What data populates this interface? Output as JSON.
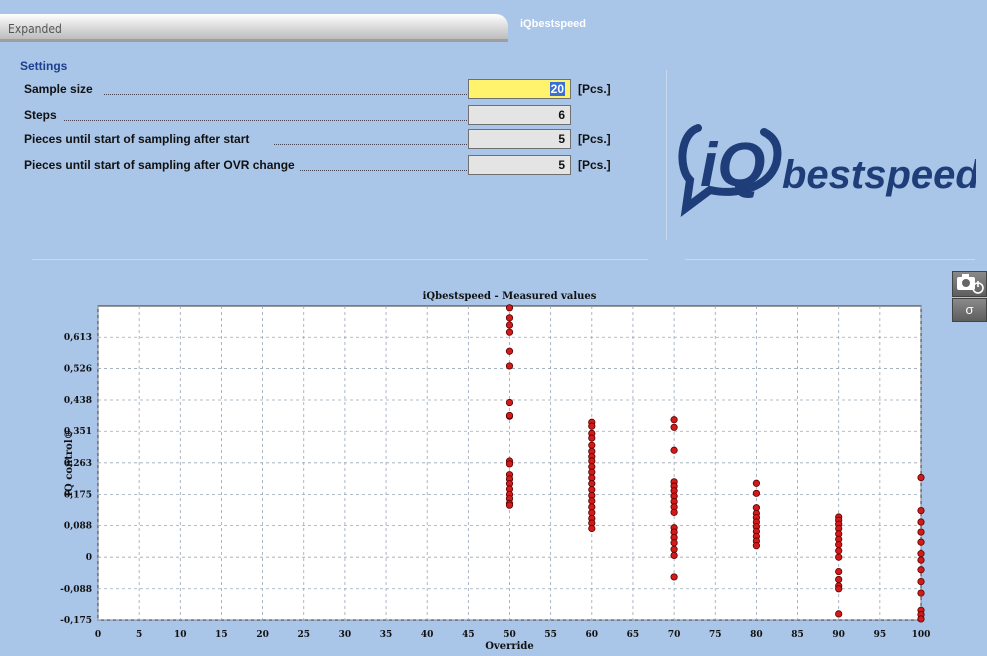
{
  "tabs": {
    "expanded": "Expanded",
    "active": "iQbestspeed"
  },
  "settings": {
    "title": "Settings",
    "rows": [
      {
        "label": "Sample size",
        "value": "20",
        "unit": "[Pcs.]"
      },
      {
        "label": "Steps",
        "value": "6",
        "unit": ""
      },
      {
        "label": "Pieces until start of sampling after start",
        "value": "5",
        "unit": "[Pcs.]"
      },
      {
        "label": "Pieces until start of sampling after OVR change",
        "value": "5",
        "unit": "[Pcs.]"
      }
    ]
  },
  "logo": {
    "mark": "iQ",
    "text": "bestspeed"
  },
  "side_buttons": {
    "camera_icon": "camera-power-icon",
    "sigma_label": "σ"
  },
  "colors": {
    "background": "#a9c5e8",
    "point": "#d11a1a",
    "field_active": "#fff36e"
  },
  "chart_data": {
    "type": "scatter",
    "title": "iQbestspeed - Measured values",
    "xlabel": "Override",
    "ylabel": "IQ control®",
    "xlim": [
      0,
      100
    ],
    "ylim": [
      -0.175,
      0.7
    ],
    "xticks": [
      "0",
      "5",
      "10",
      "15",
      "20",
      "25",
      "30",
      "35",
      "40",
      "45",
      "50",
      "55",
      "60",
      "65",
      "70",
      "75",
      "80",
      "85",
      "90",
      "95",
      "100"
    ],
    "yticks": [
      {
        "v": 0.613,
        "label": "0,613"
      },
      {
        "v": 0.526,
        "label": "0,526"
      },
      {
        "v": 0.438,
        "label": "0,438"
      },
      {
        "v": 0.351,
        "label": "0,351"
      },
      {
        "v": 0.263,
        "label": "0,263"
      },
      {
        "v": 0.175,
        "label": "0,175"
      },
      {
        "v": 0.088,
        "label": "0,088"
      },
      {
        "v": 0,
        "label": "0"
      },
      {
        "v": -0.088,
        "label": "-0,088"
      },
      {
        "v": -0.175,
        "label": "-0,175"
      }
    ],
    "grid": true,
    "series": [
      {
        "x": 50,
        "y": [
          0.695,
          0.667,
          0.647,
          0.627,
          0.574,
          0.533,
          0.431,
          0.393,
          0.395,
          0.268,
          0.26,
          0.23,
          0.218,
          0.205,
          0.19,
          0.175,
          0.163,
          0.15,
          0.145
        ]
      },
      {
        "x": 60,
        "y": [
          0.376,
          0.365,
          0.345,
          0.332,
          0.312,
          0.295,
          0.28,
          0.268,
          0.252,
          0.237,
          0.221,
          0.205,
          0.188,
          0.172,
          0.157,
          0.14,
          0.124,
          0.108,
          0.095,
          0.08
        ]
      },
      {
        "x": 70,
        "y": [
          0.383,
          0.362,
          0.298,
          0.21,
          0.198,
          0.185,
          0.17,
          0.155,
          0.14,
          0.125,
          0.082,
          0.07,
          0.055,
          0.04,
          0.022,
          0.005,
          -0.055
        ]
      },
      {
        "x": 80,
        "y": [
          0.206,
          0.178,
          0.138,
          0.122,
          0.11,
          0.098,
          0.085,
          0.072,
          0.058,
          0.045,
          0.032
        ]
      },
      {
        "x": 90,
        "y": [
          0.112,
          0.103,
          0.092,
          0.08,
          0.065,
          0.05,
          0.035,
          0.018,
          0.0,
          -0.04,
          -0.062,
          -0.08,
          -0.088,
          -0.158
        ]
      },
      {
        "x": 100,
        "y": [
          0.222,
          0.13,
          0.098,
          0.07,
          0.042,
          0.01,
          -0.008,
          -0.035,
          -0.068,
          -0.1,
          -0.148,
          -0.16,
          -0.172
        ]
      }
    ]
  }
}
